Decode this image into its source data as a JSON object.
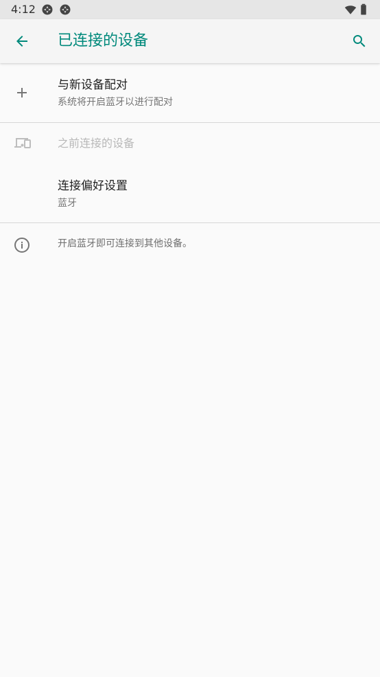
{
  "status_bar": {
    "time": "4:12",
    "icons": [
      "sync-icon",
      "sync-icon",
      "wifi-icon",
      "battery-icon"
    ]
  },
  "app_bar": {
    "title": "已连接的设备",
    "back_icon": "arrow-left-icon",
    "search_icon": "search-icon",
    "accent_color": "#00897b"
  },
  "list": {
    "pair_new": {
      "title": "与新设备配对",
      "subtitle": "系统将开启蓝牙以进行配对",
      "icon": "plus-icon"
    },
    "previously_connected": {
      "title": "之前连接的设备",
      "icon": "devices-icon"
    },
    "connection_prefs": {
      "title": "连接偏好设置",
      "subtitle": "蓝牙"
    },
    "footer": {
      "text": "开启蓝牙即可连接到其他设备。",
      "icon": "info-icon"
    }
  }
}
